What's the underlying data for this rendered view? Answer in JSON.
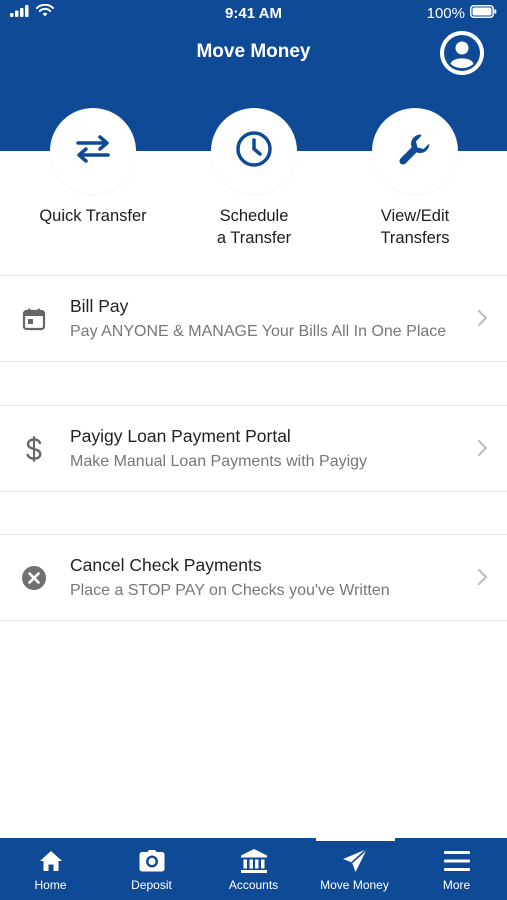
{
  "status_bar": {
    "time": "9:41 AM",
    "battery": "100%",
    "icons": [
      "signal-icon",
      "wifi-icon",
      "battery-icon"
    ]
  },
  "header": {
    "title": "Move Money",
    "profile_icon": "user-circle-icon",
    "background_color": "#0f4a96"
  },
  "quick_actions": [
    {
      "label_line1": "Quick Transfer",
      "label_line2": "",
      "icon": "transfer-arrows-icon"
    },
    {
      "label_line1": "Schedule",
      "label_line2": "a Transfer",
      "icon": "clock-icon"
    },
    {
      "label_line1": "View/Edit",
      "label_line2": "Transfers",
      "icon": "wrench-icon"
    }
  ],
  "menu_items": [
    {
      "title": "Bill Pay",
      "subtitle": "Pay ANYONE & MANAGE Your Bills All In One Place",
      "icon": "calendar-icon"
    },
    {
      "title": "Payigy Loan Payment Portal",
      "subtitle": "Make Manual Loan Payments with Payigy",
      "icon": "dollar-icon"
    },
    {
      "title": "Cancel Check Payments",
      "subtitle": "Place a STOP PAY on Checks you've Written",
      "icon": "cancel-circle-icon"
    }
  ],
  "tab_bar": {
    "active": "Move Money",
    "tabs": [
      {
        "label": "Home",
        "icon": "home-icon"
      },
      {
        "label": "Deposit",
        "icon": "camera-icon"
      },
      {
        "label": "Accounts",
        "icon": "bank-icon"
      },
      {
        "label": "Move Money",
        "icon": "paper-plane-icon"
      },
      {
        "label": "More",
        "icon": "hamburger-icon"
      }
    ]
  }
}
